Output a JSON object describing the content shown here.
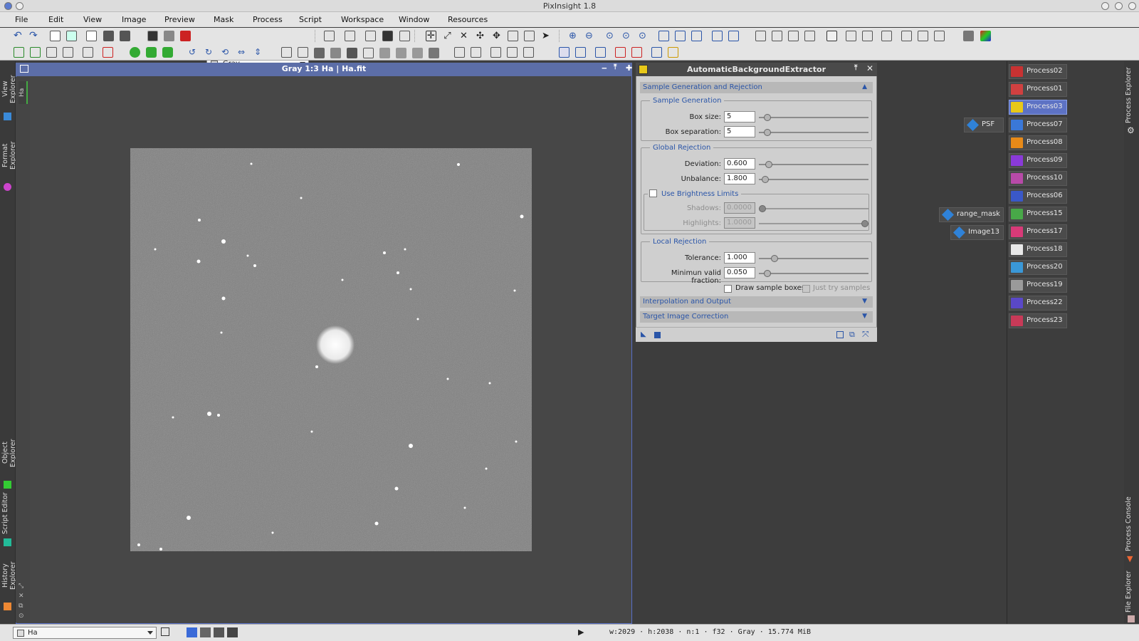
{
  "app": {
    "title": "PixInsight 1.8"
  },
  "menu": [
    "File",
    "Edit",
    "View",
    "Image",
    "Preview",
    "Mask",
    "Process",
    "Script",
    "Workspace",
    "Window",
    "Resources"
  ],
  "toolbar": {
    "color_space_value": "Gray"
  },
  "left_dock": [
    "View Explorer",
    "Format Explorer",
    "Object Explorer",
    "Script Editor",
    "History Explorer"
  ],
  "image_window": {
    "title": "Gray 1:3 Ha | Ha.fit",
    "side_tab": "Ha"
  },
  "abe": {
    "title": "AutomaticBackgroundExtractor",
    "section_sample": "Sample Generation and Rejection",
    "group_sample_gen": "Sample Generation",
    "box_size_label": "Box size:",
    "box_size": "5",
    "box_size_slider": 0.05,
    "box_sep_label": "Box separation:",
    "box_sep": "5",
    "box_sep_slider": 0.05,
    "group_global": "Global Rejection",
    "deviation_label": "Deviation:",
    "deviation": "0.600",
    "deviation_slider": 0.06,
    "unbalance_label": "Unbalance:",
    "unbalance": "1.800",
    "unbalance_slider": 0.03,
    "use_brightness": "Use Brightness Limits",
    "shadows_label": "Shadows:",
    "shadows": "0.0000",
    "shadows_slider": 0.0,
    "highlights_label": "Highlights:",
    "highlights": "1.0000",
    "highlights_slider": 1.0,
    "group_local": "Local Rejection",
    "tolerance_label": "Tolerance:",
    "tolerance": "1.000",
    "tolerance_slider": 0.12,
    "min_valid_label": "Minimun valid fraction:",
    "min_valid": "0.050",
    "min_valid_slider": 0.05,
    "draw_boxes": "Draw sample boxes",
    "just_try": "Just try samples",
    "section_interp": "Interpolation and Output",
    "section_target": "Target Image Correction"
  },
  "workspace_icons": [
    "PSF",
    "range_mask",
    "Image13"
  ],
  "process_icons": [
    {
      "name": "Process02",
      "color": "#c83232"
    },
    {
      "name": "Process01",
      "color": "#d04040"
    },
    {
      "name": "Process03",
      "color": "#e8c818",
      "selected": true
    },
    {
      "name": "Process07",
      "color": "#3a78d8"
    },
    {
      "name": "Process08",
      "color": "#e88a18"
    },
    {
      "name": "Process09",
      "color": "#8a3ad8"
    },
    {
      "name": "Process10",
      "color": "#b84aa8"
    },
    {
      "name": "Process06",
      "color": "#3a58c8"
    },
    {
      "name": "Process15",
      "color": "#48a848"
    },
    {
      "name": "Process17",
      "color": "#d83a78"
    },
    {
      "name": "Process18",
      "color": "#e8e8e8"
    },
    {
      "name": "Process20",
      "color": "#3a98d8"
    },
    {
      "name": "Process19",
      "color": "#9a9a9a"
    },
    {
      "name": "Process22",
      "color": "#5a48c8"
    },
    {
      "name": "Process23",
      "color": "#c83a58"
    }
  ],
  "right_dock": [
    "Process Explorer",
    "Process Console",
    "File Explorer"
  ],
  "statusbar": {
    "view": "Ha",
    "info": "w:2029 · h:2038 · n:1 · f32 · Gray · 15.774 MiB"
  }
}
